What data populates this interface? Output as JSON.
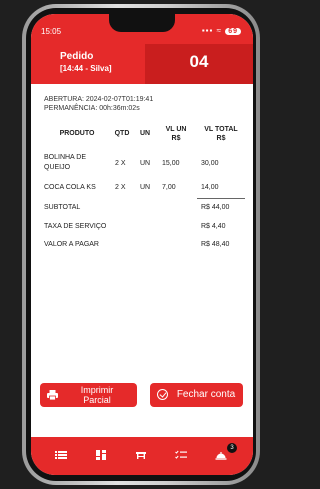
{
  "status_bar": {
    "time": "15:05",
    "signal_text": "▪▪▪ ≈",
    "battery_badge": "69"
  },
  "header": {
    "title": "Pedido",
    "subtitle": "[14:44 - Silva]",
    "order_number": "04"
  },
  "order_info": {
    "abertura": "ABERTURA: 2024-02-07T01:19:41",
    "permanencia": "PERMANÊNCIA: 00h:36m:02s"
  },
  "table": {
    "headers": {
      "produto": "PRODUTO",
      "qtd": "QTD",
      "un": "UN",
      "vl_un_line1": "VL UN",
      "vl_un_line2": "R$",
      "vl_total_line1": "VL TOTAL",
      "vl_total_line2": "R$"
    },
    "rows": [
      {
        "produto": "BOLINHA DE QUEIJO",
        "qtd": "2 X",
        "un": "UN",
        "vl_un": "15,00",
        "vl_total": "30,00"
      },
      {
        "produto": "COCA COLA KS",
        "qtd": "2 X",
        "un": "UN",
        "vl_un": "7,00",
        "vl_total": "14,00"
      }
    ]
  },
  "summary": {
    "subtotal_label": "SUBTOTAL",
    "subtotal_value": "R$ 44,00",
    "service_label": "TAXA DE SERVIÇO",
    "service_value": "R$ 4,40",
    "total_label": "VALOR A PAGAR",
    "total_value": "R$ 48,40"
  },
  "actions": {
    "print_label_line1": "Imprimir",
    "print_label_line2": "Parcial",
    "close_label": "Fechar conta"
  },
  "bottom_nav": {
    "items": [
      "list-icon",
      "dashboard-icon",
      "table-icon",
      "checklist-icon",
      "cloche-icon"
    ],
    "badge_count": "3"
  },
  "colors": {
    "primary": "#e52a2a",
    "primary_dark": "#c91e1e",
    "text": "#222222"
  }
}
